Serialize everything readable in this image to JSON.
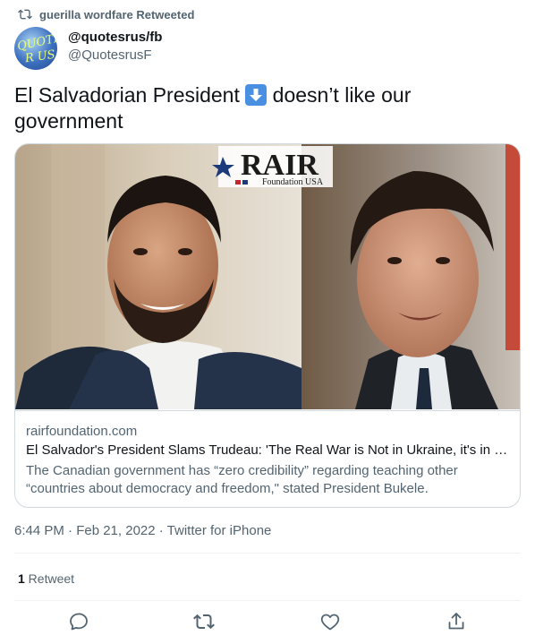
{
  "retweet_context": {
    "text": "guerilla wordfare Retweeted",
    "icon": "retweet-icon"
  },
  "author": {
    "name": "@quotesrus/fb",
    "handle": "@QuotesrusF",
    "avatar_text": [
      "QUOTES",
      "R US"
    ]
  },
  "tweet": {
    "text_before": "El Salvadorian President ",
    "emoji": "down-arrow-emoji",
    "text_after": " doesn’t like our government"
  },
  "card": {
    "logo_text": "RAIR",
    "logo_sub": "Foundation USA",
    "domain": "rairfoundation.com",
    "title": "El Salvador's President Slams Trudeau: 'The Real War is Not in Ukraine, it's in Canada'",
    "description": "The Canadian government has “zero credibility” regarding teaching other “countries about democracy and freedom,\" stated President Bukele."
  },
  "timestamp": "6:44 PM · Feb 21, 2022 · Twitter for iPhone",
  "stats": {
    "retweets_count": "1",
    "retweets_label": " Retweet"
  },
  "actions": [
    "reply-icon",
    "retweet-icon",
    "like-icon",
    "share-icon"
  ],
  "colors": {
    "text": "#0f1419",
    "secondary": "#536471",
    "border": "#cfd9de",
    "emoji_blue": "#4a90e2"
  }
}
